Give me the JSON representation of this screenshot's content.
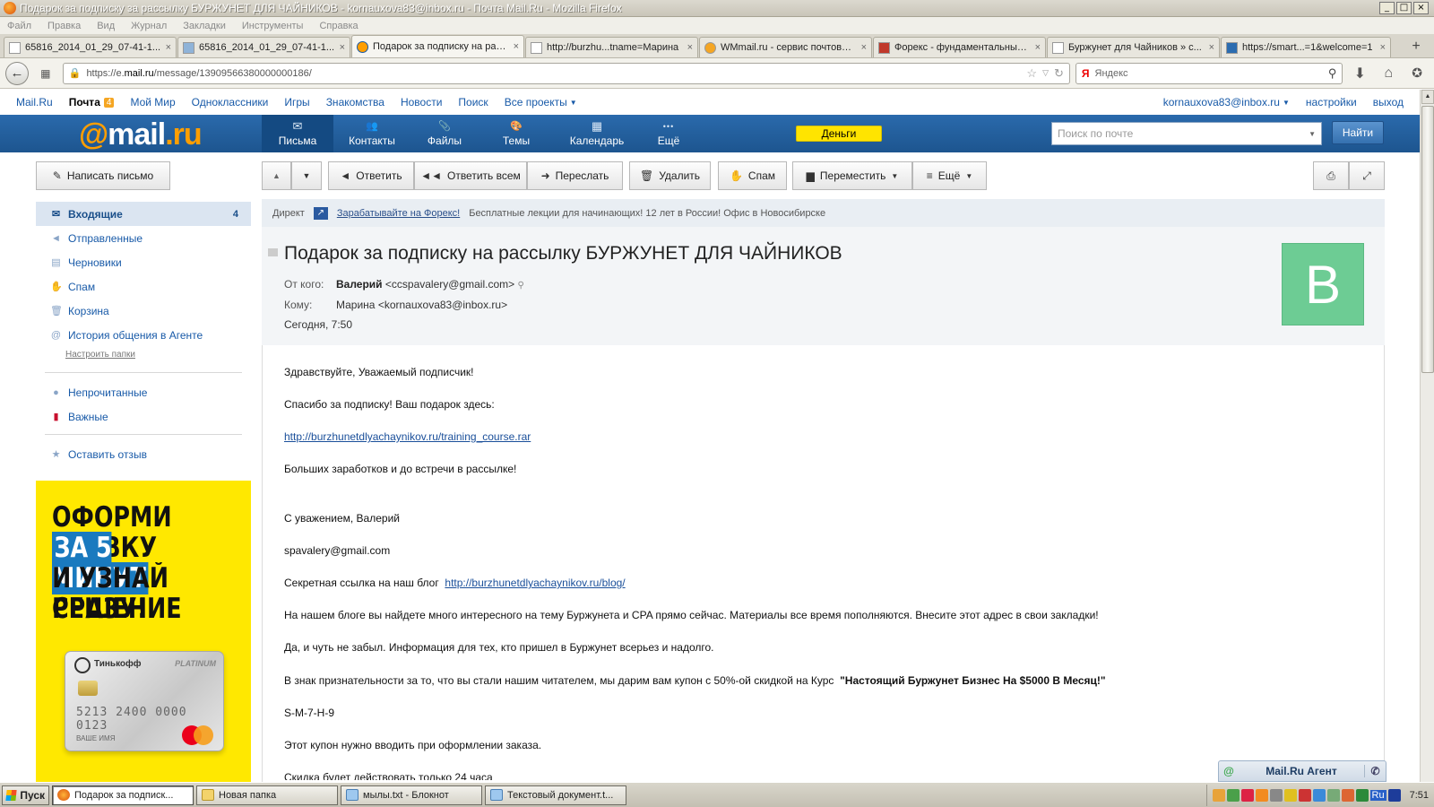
{
  "window": {
    "title": "Подарок за подписку за рассылку БУРЖУНЕТ ДЛЯ ЧАЙНИКОВ - kornauxova83@inbox.ru - Почта Mail.Ru - Mozilla Firefox",
    "buttons": [
      "_",
      "□",
      "×"
    ]
  },
  "menu": [
    "Файл",
    "Правка",
    "Вид",
    "Журнал",
    "Закладки",
    "Инструменты",
    "Справка"
  ],
  "tabs": [
    {
      "label": "65816_2014_01_29_07-41-1..."
    },
    {
      "label": "65816_2014_01_29_07-41-1..."
    },
    {
      "label": "Подарок за подписку на рас..."
    },
    {
      "label": "http://burzhu...tname=Марина"
    },
    {
      "label": "WMmail.ru - сервис почтовы..."
    },
    {
      "label": "Форекс - фундаментальный..."
    },
    {
      "label": "Буржунет для Чайников » с..."
    },
    {
      "label": "https://smart...=1&welcome=1"
    }
  ],
  "tab_close": "×",
  "newtab": "+",
  "nav": {
    "url_prefix": "https://e.",
    "url_domain": "mail.ru",
    "url_rest": "/message/13909566380000000186/",
    "search_placeholder": "Яндекс",
    "search_engine": "Я"
  },
  "portal": {
    "links": [
      "Mail.Ru",
      "Почта",
      "Мой Мир",
      "Одноклассники",
      "Игры",
      "Знакомства",
      "Новости",
      "Поиск",
      "Все проекты"
    ],
    "mail_badge": "4",
    "user": "kornauxova83@inbox.ru",
    "settings": "настройки",
    "logout": "выход"
  },
  "header": {
    "logo_at": "@",
    "logo_mail": "mail",
    "logo_ru": ".ru",
    "nav": [
      {
        "label": "Письма",
        "icon": "envelope-icon",
        "glyph": "✉"
      },
      {
        "label": "Контакты",
        "icon": "contacts-icon",
        "glyph": "👥"
      },
      {
        "label": "Файлы",
        "icon": "paperclip-icon",
        "glyph": "📎"
      },
      {
        "label": "Темы",
        "icon": "palette-icon",
        "glyph": "🎨"
      },
      {
        "label": "Календарь",
        "icon": "calendar-icon",
        "glyph": "▦"
      },
      {
        "label": "Ещё",
        "icon": "more-icon",
        "glyph": "•••"
      }
    ],
    "money": "Деньги",
    "search_placeholder": "Поиск по почте",
    "find": "Найти"
  },
  "toolbar": {
    "compose": "Написать письмо",
    "reply": "Ответить",
    "reply_all": "Ответить всем",
    "forward": "Переслать",
    "delete": "Удалить",
    "spam": "Спам",
    "move": "Переместить",
    "more": "Ещё"
  },
  "folders": {
    "items": [
      {
        "label": "Входящие",
        "count": "4"
      },
      {
        "label": "Отправленные"
      },
      {
        "label": "Черновики"
      },
      {
        "label": "Спам"
      },
      {
        "label": "Корзина"
      },
      {
        "label": "История общения в Агенте"
      }
    ],
    "configure": "Настроить папки",
    "unread": "Непрочитанные",
    "important": "Важные",
    "feedback": "Оставить отзыв"
  },
  "ad": {
    "line1": "ОФОРМИ ЗАЯВКУ",
    "line2": "ЗА 5 МИНУТ",
    "line3": "И УЗНАЙ РЕШЕНИЕ",
    "line4": "СРАЗУ!",
    "card_bank": "Тинькофф",
    "card_plat": "PLATINUM",
    "card_number": "5213 2400 0000 0123",
    "card_name": "ВАШЕ ИМЯ"
  },
  "direkt": {
    "label": "Директ",
    "link": "Зарабатывайте на Форекс!",
    "text": "Бесплатные лекции для начинающих! 12 лет в России! Офис в Новосибирске"
  },
  "message": {
    "subject": "Подарок за подписку на рассылку БУРЖУНЕТ ДЛЯ ЧАЙНИКОВ",
    "from_label": "От кого:",
    "from_name": "Валерий",
    "from_email": "<ccspavalery@gmail.com>",
    "to_label": "Кому:",
    "to": "Марина <kornauxova83@inbox.ru>",
    "date": "Сегодня, 7:50",
    "avatar_letter": "В",
    "body": {
      "greeting": "Здравствуйте, Уважаемый подписчик!",
      "thanks": "Спасибо за подписку!  Ваш подарок здесь:",
      "gift_link": "http://burzhunetdlyachaynikov.ru/training_course.rar",
      "bye": "Больших заработков и до встречи в рассылке!",
      "regards": "С уважением, Валерий",
      "email": "spavalery@gmail.com",
      "secret_label": "Секретная ссылка на наш блог",
      "blog_link": "http://burzhunetdlyachaynikov.ru/blog/",
      "blog_text": "На нашем блоге вы найдете много интересного на тему Буржунета и CPA прямо сейчас. Материалы все время пополняются. Внесите этот адрес в свои закладки!",
      "ps": "Да, и чуть не забыл. Информация для тех, кто пришел в Буржунет всерьез и надолго.",
      "coupon_text": "В знак признательности за то, что вы стали нашим читателем, мы дарим вам купон с 50%-ой скидкой на Курс",
      "course": "\"Настоящий Буржунет Бизнес На $5000 В Месяц!\"",
      "code": "S-M-7-H-9",
      "coupon_note": "Этот купон нужно вводить при оформлении заказа.",
      "valid": "Скидка будет действовать только 24 часа"
    }
  },
  "agent": {
    "label": "Mail.Ru Агент",
    "at": "@",
    "phone": "✆"
  },
  "taskbar": {
    "start": "Пуск",
    "tasks": [
      "Подарок за подпиcк...",
      "Новая папка",
      "мылы.txt - Блокнот",
      "Текстовый документ.t..."
    ],
    "lang": "Ru",
    "time": "7:51"
  }
}
